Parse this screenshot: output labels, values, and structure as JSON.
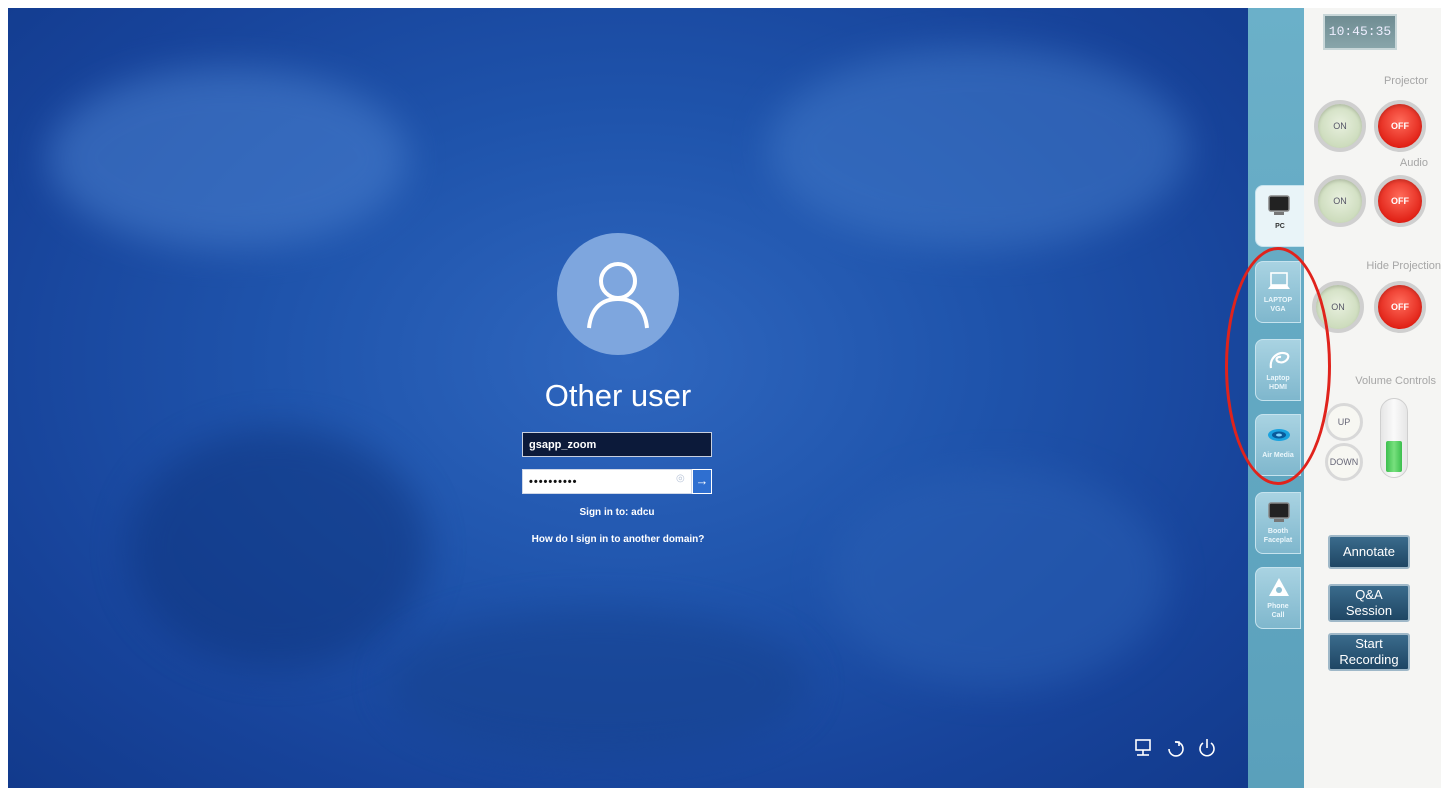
{
  "login": {
    "display_name": "Other user",
    "username_value": "gsapp_zoom",
    "password_value": "••••••••••",
    "sign_in_to": "Sign in to: adcu",
    "domain_link": "How do I sign in to another domain?",
    "submit_glyph": "→"
  },
  "bottom_icons": [
    "network-icon",
    "accessibility-icon",
    "power-icon"
  ],
  "source_tabs": [
    {
      "name": "pc",
      "label_lines": [
        "PC"
      ],
      "icon": "monitor-icon",
      "active": true
    },
    {
      "name": "laptop-vga",
      "label_lines": [
        "LAPTOP",
        "VGA"
      ],
      "icon": "laptop-icon",
      "active": false
    },
    {
      "name": "laptop-hdmi",
      "label_lines": [
        "Laptop",
        "HDMI"
      ],
      "icon": "hdmi-cable-icon",
      "active": false
    },
    {
      "name": "air-media",
      "label_lines": [
        "Air Media"
      ],
      "icon": "air-media-icon",
      "active": false
    },
    {
      "name": "booth-faceplate",
      "label_lines": [
        "Booth",
        "Faceplat"
      ],
      "icon": "monitor-icon",
      "active": false
    },
    {
      "name": "phone-call",
      "label_lines": [
        "Phone",
        "Call"
      ],
      "icon": "phone-icon",
      "active": false
    }
  ],
  "panel": {
    "clock": "10:45:35",
    "projector_label": "Projector",
    "audio_label": "Audio",
    "hide_projection_label": "Hide Projection",
    "volume_label": "Volume Controls",
    "on_label": "ON",
    "off_label": "OFF",
    "up_label": "UP",
    "down_label": "DOWN",
    "volume_level": 0.45,
    "annotate_label": "Annotate",
    "qa_line1": "Q&A",
    "qa_line2": "Session",
    "record_line1": "Start",
    "record_line2": "Recording"
  },
  "colors": {
    "annotation_circle": "#e0231c",
    "off_red": "#e01f14",
    "on_green": "#c9d9b8",
    "panel_tab_blue": "#6bb0c9"
  }
}
